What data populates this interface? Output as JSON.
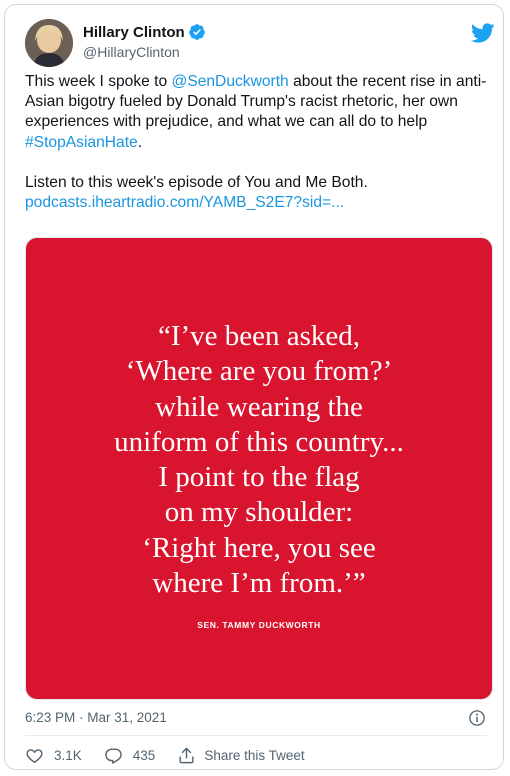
{
  "author": {
    "name": "Hillary Clinton",
    "handle": "@HillaryClinton",
    "verified": true
  },
  "tweet": {
    "lines": [
      {
        "pre": "This week I spoke to ",
        "mention": "@SenDuckworth",
        "post": " about the recent rise in anti-Asian bigotry fueled by Donald Trump's racist rhetoric, her own experiences with prejudice, and what we can all do to help ",
        "hashtag": "#StopAsianHate",
        "end": "."
      }
    ],
    "listen_text": "Listen to this week's episode of You and Me Both.",
    "link": "podcasts.iheartradio.com/YAMB_S2E7?sid=..."
  },
  "media": {
    "quote_lines": [
      "“I’ve been asked,",
      "‘Where are you from?’",
      "while wearing the",
      "uniform of this country...",
      "I point to the flag",
      "on my shoulder:",
      "‘Right here, you see",
      "where I’m from.’”"
    ],
    "attribution": "SEN. TAMMY DUCKWORTH",
    "background": "#d8142e"
  },
  "meta": {
    "timestamp": "6:23 PM · Mar 31, 2021"
  },
  "actions": {
    "likes": "3.1K",
    "replies": "435",
    "share_label": "Share this Tweet"
  },
  "colors": {
    "link": "#1b95e0",
    "secondary": "#536471",
    "twitter_blue": "#1da1f2"
  },
  "icons": [
    "twitter-bird-icon",
    "verified-badge-icon",
    "info-icon",
    "heart-icon",
    "reply-icon",
    "share-icon"
  ]
}
